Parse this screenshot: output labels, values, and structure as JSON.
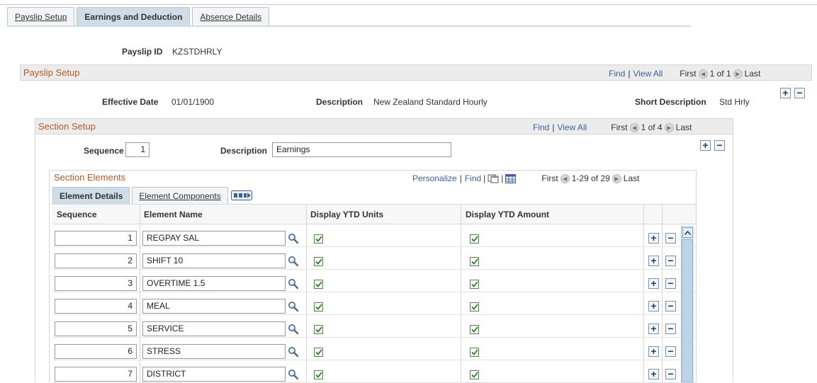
{
  "tabs": [
    {
      "label": "Payslip Setup",
      "active": false
    },
    {
      "label": "Earnings and Deduction",
      "active": true
    },
    {
      "label": "Absence Details",
      "active": false
    }
  ],
  "payslip": {
    "id_label": "Payslip ID",
    "id_value": "KZSTDHRLY"
  },
  "payslip_setup": {
    "title": "Payslip Setup",
    "find": "Find",
    "sep": "|",
    "view_all": "View All",
    "first": "First",
    "count": "1 of 1",
    "last": "Last",
    "effective_date_label": "Effective Date",
    "effective_date": "01/01/1900",
    "description_label": "Description",
    "description": "New Zealand Standard Hourly",
    "short_desc_label": "Short Description",
    "short_desc": "Std Hrly"
  },
  "section_setup": {
    "title": "Section Setup",
    "find": "Find",
    "sep": "|",
    "view_all": "View All",
    "first": "First",
    "count": "1 of 4",
    "last": "Last",
    "sequence_label": "Sequence",
    "sequence": "1",
    "description_label": "Description",
    "description": "Earnings"
  },
  "section_elements": {
    "title": "Section Elements",
    "personalize": "Personalize",
    "sep1": "|",
    "find": "Find",
    "sep2": "|",
    "sep3": "|",
    "first": "First",
    "count": "1-29 of 29",
    "last": "Last",
    "subtabs": [
      {
        "label": "Element Details",
        "active": true
      },
      {
        "label": "Element Components",
        "active": false
      }
    ],
    "columns": {
      "sequence": "Sequence",
      "element_name": "Element Name",
      "ytd_units": "Display YTD Units",
      "ytd_amount": "Display YTD Amount"
    },
    "rows": [
      {
        "seq": "1",
        "name": "REGPAY SAL",
        "units": true,
        "amount": true
      },
      {
        "seq": "2",
        "name": "SHIFT 10",
        "units": true,
        "amount": true
      },
      {
        "seq": "3",
        "name": "OVERTIME 1.5",
        "units": true,
        "amount": true
      },
      {
        "seq": "4",
        "name": "MEAL",
        "units": true,
        "amount": true
      },
      {
        "seq": "5",
        "name": "SERVICE",
        "units": true,
        "amount": true
      },
      {
        "seq": "6",
        "name": "STRESS",
        "units": true,
        "amount": true
      },
      {
        "seq": "7",
        "name": "DISTRICT",
        "units": true,
        "amount": true
      }
    ]
  },
  "icons": {
    "add": "+",
    "remove": "−",
    "nav_prev": "◀",
    "nav_next": "▶"
  }
}
